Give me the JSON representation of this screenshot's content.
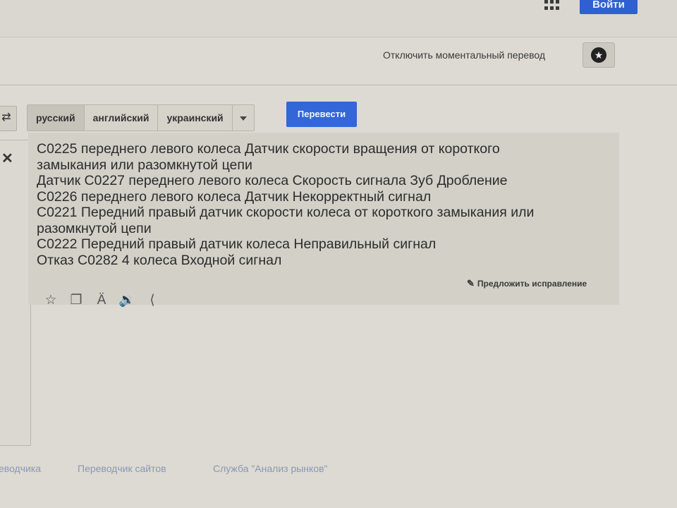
{
  "header": {
    "login_label": "Войти",
    "apps_icon": "apps-grid-icon"
  },
  "toolbar": {
    "instant_translate_label": "Отключить моментальный перевод",
    "star_icon": "star-icon"
  },
  "languages": {
    "tabs": [
      "русский",
      "английский",
      "украинский"
    ],
    "selected": "русский",
    "dropdown_icon": "chevron-down-icon",
    "swap_icon": "swap-arrows-icon"
  },
  "translate_button": "Перевести",
  "result": {
    "lines": [
      "C0225 переднего левого колеса Датчик скорости вращения от короткого",
      "замыкания или разомкнутой цепи",
      "Датчик C0227 переднего левого колеса Скорость сигнала Зуб Дробление",
      "C0226 переднего левого колеса Датчик Некорректный сигнал",
      "C0221 Передний правый датчик скорости колеса от короткого замыкания или",
      "разомкнутой цепи",
      "C0222 Передний правый датчик колеса Неправильный сигнал",
      "Отказ C0282 4 колеса Входной сигнал"
    ],
    "suggest_label": "Предложить исправление",
    "action_icons": [
      "star-outline-icon",
      "copy-icon",
      "transliterate-icon",
      "speaker-icon",
      "share-icon"
    ]
  },
  "footer": {
    "links": [
      "еводчика",
      "Переводчик сайтов",
      "Служба \"Анализ рынков\""
    ]
  }
}
